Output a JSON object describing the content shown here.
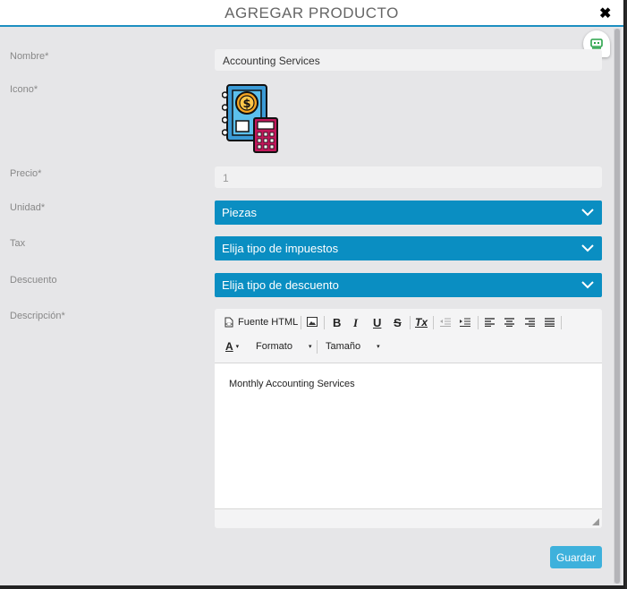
{
  "modal": {
    "title": "AGREGAR PRODUCTO",
    "close_label": "✖"
  },
  "form": {
    "nombre": {
      "label": "Nombre*",
      "value": "Accounting Services"
    },
    "icono": {
      "label": "Icono*"
    },
    "precio": {
      "label": "Precio*",
      "value": "1"
    },
    "unidad": {
      "label": "Unidad*",
      "value": "Piezas"
    },
    "tax": {
      "label": "Tax",
      "value": "Elija tipo de impuestos"
    },
    "descuento": {
      "label": "Descuento",
      "value": "Elija tipo de descuento"
    },
    "descripcion": {
      "label": "Descripción*",
      "content": "Monthly Accounting Services"
    }
  },
  "editor": {
    "source_label": "Fuente HTML",
    "bold": "B",
    "italic": "I",
    "underline": "U",
    "strike": "S",
    "clear": "Tx",
    "color_label": "A",
    "format_label": "Formato",
    "size_label": "Tamaño"
  },
  "actions": {
    "save_label": "Guardar"
  },
  "colors": {
    "accent": "#0a8ec2",
    "button": "#3eb1dc",
    "header_line": "#1d8fc1"
  }
}
